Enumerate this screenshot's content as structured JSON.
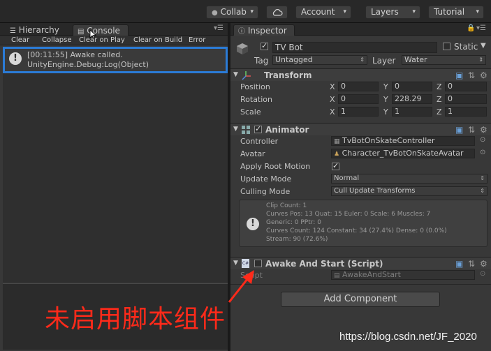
{
  "toolbar": {
    "collab": "Collab",
    "account": "Account",
    "layers": "Layers",
    "layout": "Tutorial"
  },
  "left_tabs": {
    "hierarchy": "Hierarchy",
    "console": "Console"
  },
  "console_toolbar": {
    "clear": "Clear",
    "collapse": "Collapse",
    "clear_on_play": "Clear on Play",
    "clear_on_build": "Clear on Build",
    "error_pause": "Error Pause"
  },
  "log": {
    "line1": "[00:11:55] Awake called.",
    "line2": "UnityEngine.Debug:Log(Object)"
  },
  "inspector": {
    "tab": "Inspector",
    "object_name": "TV Bot",
    "static_label": "Static",
    "tag_label": "Tag",
    "tag_value": "Untagged",
    "layer_label": "Layer",
    "layer_value": "Water",
    "transform": {
      "title": "Transform",
      "rows": [
        {
          "label": "Position",
          "x": "0",
          "y": "0",
          "z": "0"
        },
        {
          "label": "Rotation",
          "x": "0",
          "y": "228.29",
          "z": "0"
        },
        {
          "label": "Scale",
          "x": "1",
          "y": "1",
          "z": "1"
        }
      ]
    },
    "animator": {
      "title": "Animator",
      "controller_label": "Controller",
      "controller_value": "TvBotOnSkateController",
      "avatar_label": "Avatar",
      "avatar_value": "Character_TvBotOnSkateAvatar",
      "root_motion_label": "Apply Root Motion",
      "update_label": "Update Mode",
      "update_value": "Normal",
      "culling_label": "Culling Mode",
      "culling_value": "Cull Update Transforms",
      "info": [
        "Clip Count: 1",
        "Curves Pos: 13 Quat: 15 Euler: 0 Scale: 6 Muscles: 7",
        "Generic: 0 PPtr: 0",
        "Curves Count: 124 Constant: 34 (27.4%) Dense: 0 (0.0%)",
        "Stream: 90 (72.6%)"
      ]
    },
    "script": {
      "title": "Awake And Start (Script)",
      "label": "Script",
      "value": "AwakeAndStart"
    },
    "add_component": "Add Component"
  },
  "annotation": {
    "text": "未启用脚本组件",
    "color": "#ff2a1a"
  },
  "watermark": "https://blog.csdn.net/JF_2020",
  "colors": {
    "highlight_border": "#2b7bd6"
  }
}
